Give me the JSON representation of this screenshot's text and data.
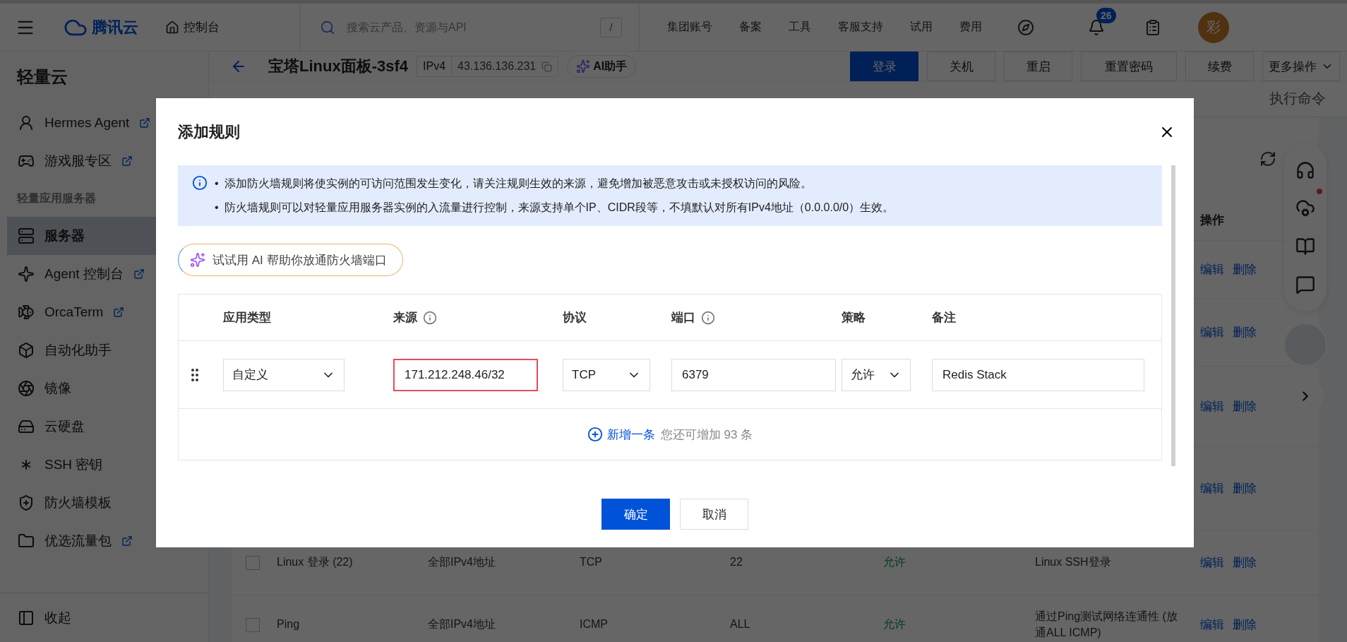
{
  "topbar": {
    "brand": "腾讯云",
    "console": "控制台",
    "search": {
      "placeholder": "搜索云产品、资源与API",
      "shortcut": "/"
    },
    "nav": [
      "集团账号",
      "备案",
      "工具",
      "客服支持",
      "试用",
      "费用"
    ],
    "notification_count": "26",
    "avatar": "彩"
  },
  "sidebar": {
    "title": "轻量云",
    "items": [
      {
        "kind": "link",
        "label": "Hermes Agent",
        "external": true,
        "selected": false
      },
      {
        "kind": "link",
        "label": "游戏服专区",
        "external": true,
        "selected": false
      },
      {
        "kind": "group",
        "label": "轻量应用服务器"
      },
      {
        "kind": "link",
        "label": "服务器",
        "external": false,
        "selected": true
      },
      {
        "kind": "link",
        "label": "Agent 控制台",
        "external": true,
        "selected": false
      },
      {
        "kind": "link",
        "label": "OrcaTerm",
        "external": true,
        "selected": false
      },
      {
        "kind": "link",
        "label": "自动化助手",
        "external": false,
        "selected": false
      },
      {
        "kind": "link",
        "label": "镜像",
        "external": false,
        "selected": false
      },
      {
        "kind": "link",
        "label": "云硬盘",
        "external": false,
        "selected": false
      },
      {
        "kind": "link",
        "label": "SSH 密钥",
        "external": false,
        "selected": false
      },
      {
        "kind": "link",
        "label": "防火墙模板",
        "external": false,
        "selected": false
      },
      {
        "kind": "link",
        "label": "优选流量包",
        "external": true,
        "selected": false
      }
    ],
    "collapse": "收起"
  },
  "instance": {
    "name": "宝塔Linux面板-3sf4",
    "ip_type": "IPv4",
    "ip": "43.136.136.231",
    "assistant": "AI助手",
    "actions": [
      {
        "label": "登录",
        "primary": true,
        "dropdown": false
      },
      {
        "label": "关机",
        "primary": false,
        "dropdown": false
      },
      {
        "label": "重启",
        "primary": false,
        "dropdown": false
      },
      {
        "label": "重置密码",
        "primary": false,
        "dropdown": false
      },
      {
        "label": "续费",
        "primary": false,
        "dropdown": false
      },
      {
        "label": "更多操作",
        "primary": false,
        "dropdown": true
      }
    ]
  },
  "tabs": [
    {
      "label": "执行命令",
      "selected": false
    }
  ],
  "firewall_table": {
    "columns": [
      "操作"
    ],
    "rows": [
      {
        "actions": [
          "编辑",
          "删除"
        ]
      },
      {
        "actions": [
          "编辑",
          "删除"
        ]
      },
      {
        "actions": [
          "编辑",
          "删除"
        ]
      },
      {
        "actions": [
          "编辑",
          "删除"
        ]
      },
      {
        "checked": false,
        "name": "Linux 登录 (22)",
        "source": "全部IPv4地址",
        "protocol": "TCP",
        "port": "22",
        "policy": "允许",
        "note": "Linux SSH登录",
        "actions": [
          "编辑",
          "删除"
        ]
      },
      {
        "checked": false,
        "name": "Ping",
        "source": "全部IPv4地址",
        "protocol": "ICMP",
        "port": "ALL",
        "policy": "允许",
        "note": "通过Ping测试网络连通性 (放通ALL ICMP)",
        "actions": [
          "编辑",
          "删除"
        ]
      }
    ]
  },
  "dialog": {
    "title": "添加规则",
    "notices": [
      {
        "marker": "•",
        "text": "添加防火墙规则将使实例的可访问范围发生变化，请关注规则生效的来源，避免增加被恶意攻击或未授权访问的风险。"
      },
      {
        "marker": "•",
        "text": "防火墙规则可以对轻量应用服务器实例的入流量进行控制，来源支持单个IP、CIDR段等，不填默认对所有IPv4地址（0.0.0.0/0）生效。"
      }
    ],
    "ai_button": "试试用 AI 帮助你放通防火墙端口",
    "columns": [
      {
        "label": "应用类型",
        "info": false
      },
      {
        "label": "来源",
        "info": true
      },
      {
        "label": "协议",
        "info": false
      },
      {
        "label": "端口",
        "info": true
      },
      {
        "label": "策略",
        "info": false
      },
      {
        "label": "备注",
        "info": false
      }
    ],
    "rows": [
      {
        "cells": [
          {
            "kind": "select",
            "value": "自定义",
            "highlighted": false
          },
          {
            "kind": "input",
            "value": "171.212.248.46/32",
            "highlighted": true
          },
          {
            "kind": "select",
            "value": "TCP",
            "highlighted": false
          },
          {
            "kind": "input",
            "value": "6379",
            "highlighted": false
          },
          {
            "kind": "select",
            "value": "允许",
            "highlighted": false
          },
          {
            "kind": "input",
            "value": "Redis Stack",
            "highlighted": false
          }
        ]
      }
    ],
    "add_link": "新增一条",
    "remaining": "您还可增加 93 条",
    "buttons": [
      {
        "label": "确定",
        "primary": true
      },
      {
        "label": "取消",
        "primary": false
      }
    ]
  }
}
